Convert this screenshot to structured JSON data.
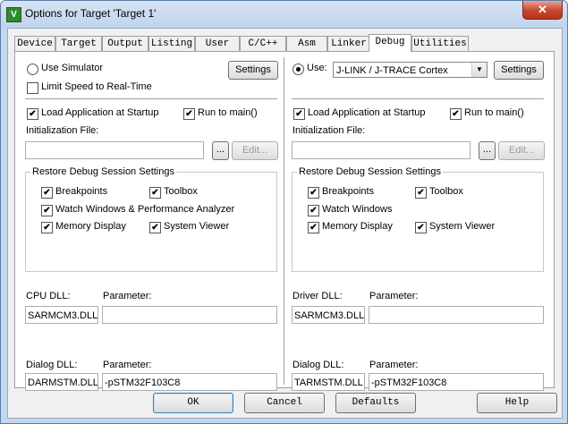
{
  "window": {
    "title": "Options for Target 'Target 1'",
    "app_icon_letter": "V",
    "close_glyph": "✕"
  },
  "tabs": [
    "Device",
    "Target",
    "Output",
    "Listing",
    "User",
    "C/C++",
    "Asm",
    "Linker",
    "Debug",
    "Utilities"
  ],
  "active_tab": "Debug",
  "left": {
    "use_simulator": "Use Simulator",
    "limit_speed": "Limit Speed to Real-Time",
    "settings": "Settings",
    "load_app": "Load Application at Startup",
    "run_to_main": "Run to main()",
    "init_file_label": "Initialization File:",
    "init_file_value": "",
    "browse": "...",
    "edit": "Edit...",
    "restore_group": "Restore Debug Session Settings",
    "breakpoints": "Breakpoints",
    "toolbox": "Toolbox",
    "watch": "Watch Windows & Performance Analyzer",
    "memory": "Memory Display",
    "system_viewer": "System Viewer",
    "cpu_dll_label": "CPU DLL:",
    "cpu_dll_value": "SARMCM3.DLL",
    "cpu_param_label": "Parameter:",
    "cpu_param_value": "",
    "dialog_dll_label": "Dialog DLL:",
    "dialog_dll_value": "DARMSTM.DLL",
    "dialog_param_label": "Parameter:",
    "dialog_param_value": "-pSTM32F103C8"
  },
  "right": {
    "use": "Use:",
    "driver": "J-LINK / J-TRACE Cortex",
    "dropdown_glyph": "▼",
    "settings": "Settings",
    "load_app": "Load Application at Startup",
    "run_to_main": "Run to main()",
    "init_file_label": "Initialization File:",
    "init_file_value": "",
    "browse": "...",
    "edit": "Edit...",
    "restore_group": "Restore Debug Session Settings",
    "breakpoints": "Breakpoints",
    "toolbox": "Toolbox",
    "watch": "Watch Windows",
    "memory": "Memory Display",
    "system_viewer": "System Viewer",
    "driver_dll_label": "Driver DLL:",
    "driver_dll_value": "SARMCM3.DLL",
    "driver_param_label": "Parameter:",
    "driver_param_value": "",
    "dialog_dll_label": "Dialog DLL:",
    "dialog_dll_value": "TARMSTM.DLL",
    "dialog_param_label": "Parameter:",
    "dialog_param_value": "-pSTM32F103C8"
  },
  "check_glyph": "✔",
  "footer": {
    "ok": "OK",
    "cancel": "Cancel",
    "defaults": "Defaults",
    "help": "Help"
  }
}
